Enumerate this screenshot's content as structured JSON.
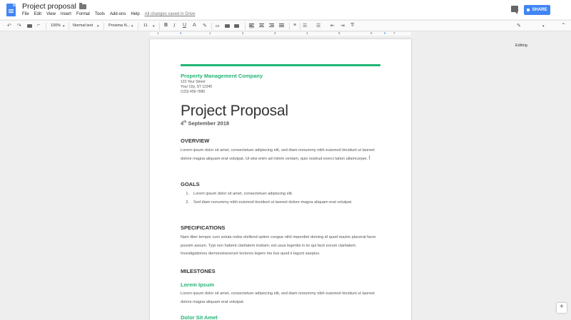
{
  "app": {
    "title": "Project proposal",
    "menu": [
      "File",
      "Edit",
      "View",
      "Insert",
      "Format",
      "Tools",
      "Add-ons",
      "Help"
    ],
    "save_status": "All changes saved in Drive",
    "share_label": "SHARE",
    "brand_color": "#4285f4"
  },
  "toolbar": {
    "zoom": "100%",
    "style": "Normal text",
    "font": "Proxima N...",
    "size": "11",
    "mode": "Editing",
    "ruler_marks": [
      "1",
      "1",
      "2",
      "3",
      "4",
      "5",
      "6",
      "7"
    ]
  },
  "doc": {
    "accent_color": "#23b575",
    "company": "Property Management Company",
    "address": [
      "123 Your Street",
      "Your City, ST 12345",
      "(123) 456-7890"
    ],
    "title": "Project Proposal",
    "date_day": "4",
    "date_suffix": "th",
    "date_rest": " September 2018",
    "overview": {
      "heading": "OVERVIEW",
      "text": "Lorem ipsum dolor sit amet, consectetuer adipiscing elit, sed diam nonummy nibh euismod tincidunt ut laoreet dolore magna aliquam erat volutpat. Ut wisi enim ad minim veniam, quis nostrud exerci tation ullamcorper."
    },
    "goals": {
      "heading": "GOALS",
      "items": [
        {
          "num": "1.",
          "text": "Lorem ipsum dolor sit amet, consectetuer adipiscing elit."
        },
        {
          "num": "2.",
          "text": "Sed diam nonummy nibh euismod tincidunt ut laoreet dolore magna aliquam erat volutpat."
        }
      ]
    },
    "specifications": {
      "heading": "SPECIFICATIONS",
      "text": "Nam liber tempor cum soluta nobis eleifend option congue nihil imperdiet doming id quod mazim placerat facer possim assum. Typi non habent claritatem insitam; est usus legentis in iis qui facit eorum claritatem. Investigationes demonstraverunt lectores legere me lius quod ii legunt saepius."
    },
    "milestones": {
      "heading": "MILESTONES",
      "sub1": "Lorem Ipsum",
      "sub1_text": "Lorem ipsum dolor sit amet, consectetuer adipiscing elit, sed diam nonummy nibh euismod tincidunt ut laoreet dolore magna aliquam erat volutpat.",
      "sub2": "Dolor Sit Amet"
    }
  }
}
